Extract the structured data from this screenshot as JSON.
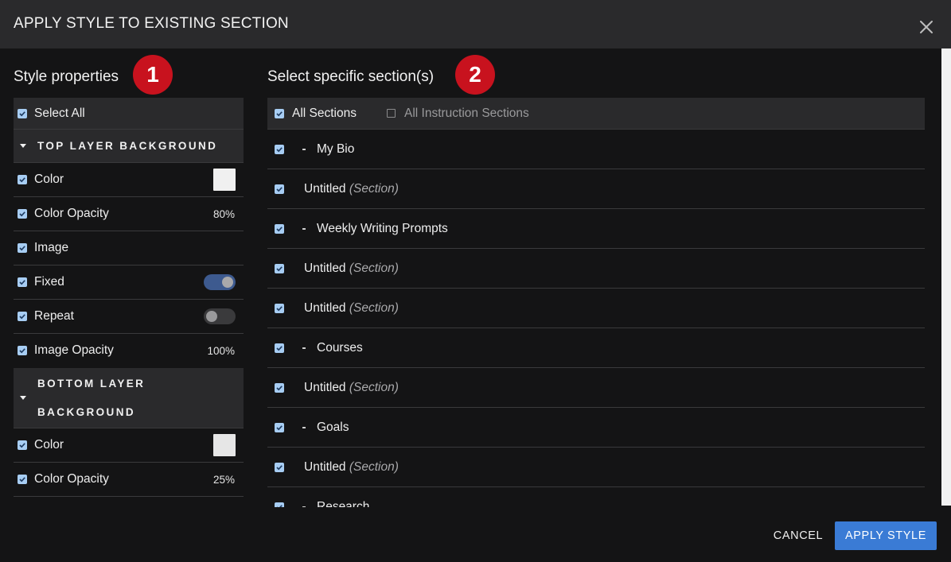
{
  "dialog": {
    "title": "APPLY STYLE TO EXISTING SECTION"
  },
  "left": {
    "heading": "Style properties",
    "badge": "1",
    "select_all": "Select All",
    "groups": [
      {
        "label": "TOP LAYER BACKGROUND",
        "props": [
          {
            "label": "Color",
            "type": "swatch",
            "swatch": "#f0f0f0"
          },
          {
            "label": "Color Opacity",
            "value": "80%"
          },
          {
            "label": "Image"
          },
          {
            "label": "Fixed",
            "type": "toggle",
            "on": true
          },
          {
            "label": "Repeat",
            "type": "toggle",
            "on": false
          },
          {
            "label": "Image Opacity",
            "value": "100%"
          }
        ]
      },
      {
        "label_line1": "BOTTOM LAYER",
        "label_line2": "BACKGROUND",
        "props": [
          {
            "label": "Color",
            "type": "swatch",
            "swatch": "#e6e6e6"
          },
          {
            "label": "Color Opacity",
            "value": "25%"
          }
        ]
      }
    ]
  },
  "right": {
    "heading": "Select specific section(s)",
    "badge": "2",
    "all_sections": "All Sections",
    "all_instruction_sections": "All Instruction Sections",
    "sections": [
      {
        "name": "My Bio",
        "page": true
      },
      {
        "name": "Untitled",
        "suffix": "(Section)"
      },
      {
        "name": "Weekly Writing Prompts",
        "page": true
      },
      {
        "name": "Untitled",
        "suffix": "(Section)"
      },
      {
        "name": "Untitled",
        "suffix": "(Section)"
      },
      {
        "name": "Courses",
        "page": true
      },
      {
        "name": "Untitled",
        "suffix": "(Section)"
      },
      {
        "name": "Goals",
        "page": true
      },
      {
        "name": "Untitled",
        "suffix": "(Section)"
      },
      {
        "name": "Research",
        "page": true
      }
    ]
  },
  "footer": {
    "cancel": "CANCEL",
    "apply": "APPLY STYLE"
  },
  "colors": {
    "accent": "#3a7bd5",
    "badge": "#c8121e",
    "checkbox": "#a7cdf3",
    "toggle_on": "#3d5a8f"
  }
}
